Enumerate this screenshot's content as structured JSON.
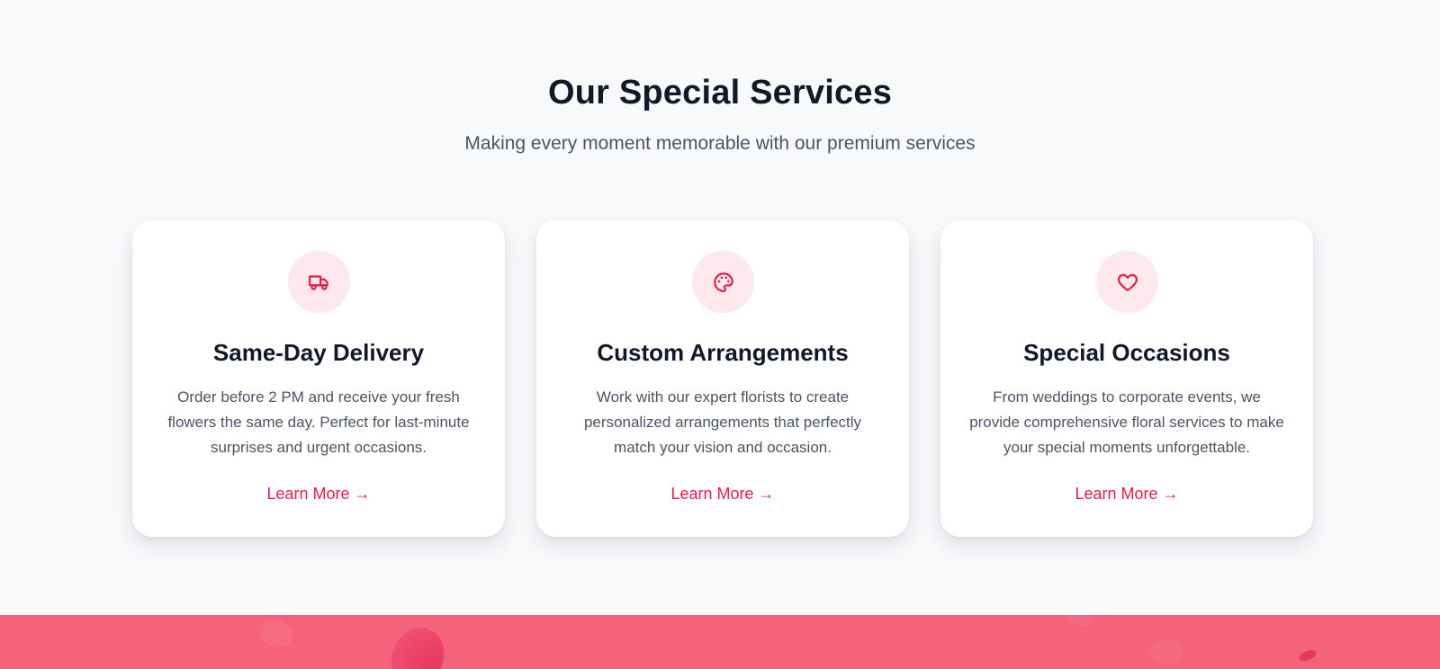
{
  "section": {
    "title": "Our Special Services",
    "subtitle": "Making every moment memorable with our premium services"
  },
  "cards": [
    {
      "icon": "truck-icon",
      "title": "Same-Day Delivery",
      "description": "Order before 2 PM and receive your fresh flowers the same day. Perfect for last-minute surprises and urgent occasions.",
      "link": "Learn More →"
    },
    {
      "icon": "palette-icon",
      "title": "Custom Arrangements",
      "description": "Work with our expert florists to create personalized arrangements that perfectly match your vision and occasion.",
      "link": "Learn More →"
    },
    {
      "icon": "heart-icon",
      "title": "Special Occasions",
      "description": "From weddings to corporate events, we provide comprehensive floral services to make your special moments unforgettable.",
      "link": "Learn More →"
    }
  ],
  "colors": {
    "accent": "#e11d48",
    "icon_bg": "#fde8ed",
    "band": "#f5637b",
    "page_bg": "#f8f9fb",
    "heading": "#111827",
    "body_text": "#4b5563"
  }
}
